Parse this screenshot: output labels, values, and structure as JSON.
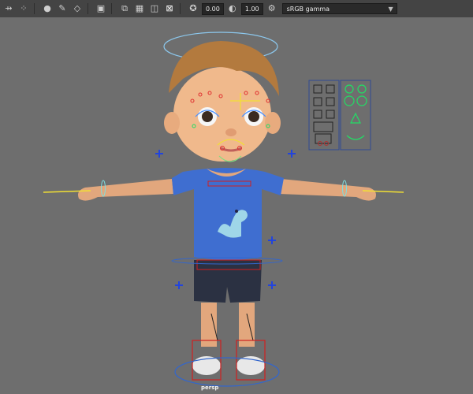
{
  "toolbar": {
    "icons": [
      "move-icon",
      "dots-icon",
      "bulb-icon",
      "paint-icon",
      "diamond-icon",
      "snapshot-icon",
      "overlay-icon",
      "grid-icon",
      "render-icon",
      "frame-icon",
      "camera-icon",
      "exposure-icon",
      "gamma-icon",
      "color-icon"
    ],
    "exposure": "0.00",
    "gamma": "1.00",
    "color_space": "sRGB gamma"
  },
  "viewport": {
    "camera_label": "persp",
    "background_color": "#6e6e6e"
  }
}
